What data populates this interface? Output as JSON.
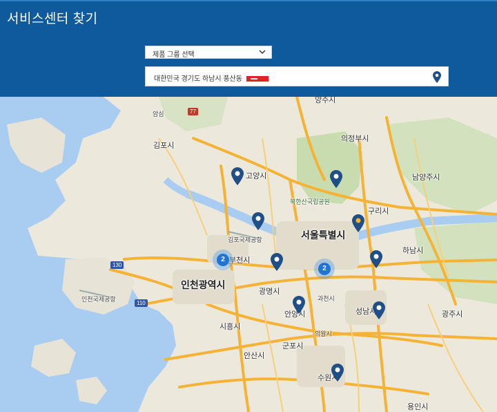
{
  "header": {
    "title": "서비스센터 찾기"
  },
  "form": {
    "product_group_select": "제품 그룹 선택",
    "address_value": "대한민국 경기도 하남시 풍산동"
  },
  "map": {
    "labels": {
      "yangju": "양주시",
      "uijeongbu": "의정부시",
      "namyangju": "남양주시",
      "gimpo": "김포시",
      "goyang": "고양시",
      "guri": "구리시",
      "bukhansan": "북한산국립공원",
      "gimpo_airport": "김포국제공항",
      "seoul": "서울특별시",
      "hanam": "하남시",
      "bucheon": "부천시",
      "incheon": "인천광역시",
      "incheon_airport": "인천국제공항",
      "gwangmyeong": "광명시",
      "gwacheon": "과천시",
      "seongnam": "성남시",
      "gwangju": "광주시",
      "anyang": "안양시",
      "uiwang": "의왕시",
      "siheung": "시흥시",
      "gunpo": "군포시",
      "ansan": "안산시",
      "suwon": "수원시",
      "yongin": "용인시",
      "amsim": "암심"
    },
    "clusters": {
      "bucheon_count": "2",
      "seoul_count": "2"
    },
    "road_shields": {
      "r77": "77",
      "r130": "130",
      "r110": "110"
    }
  },
  "colors": {
    "header_bg": "#0f5a9c",
    "marker": "#1f4f86",
    "cluster": "#1f74d8",
    "road": "#f5b335",
    "water": "#a9cdf0",
    "land": "#ede8dc"
  }
}
